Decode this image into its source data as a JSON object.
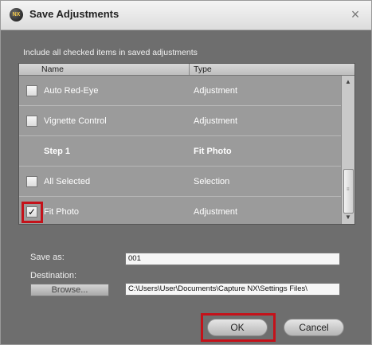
{
  "window": {
    "title": "Save Adjustments",
    "logo_text": "NX",
    "close_glyph": "×"
  },
  "instruction": "Include all checked items in saved adjustments",
  "list": {
    "columns": [
      "Name",
      "Type"
    ],
    "rows": [
      {
        "name": "Auto Red-Eye",
        "type": "Adjustment",
        "checked": false,
        "has_checkbox": true,
        "bold": false
      },
      {
        "name": "Vignette Control",
        "type": "Adjustment",
        "checked": false,
        "has_checkbox": true,
        "bold": false
      },
      {
        "name": "Step 1",
        "type": "Fit Photo",
        "checked": false,
        "has_checkbox": false,
        "bold": true
      },
      {
        "name": "All Selected",
        "type": "Selection",
        "checked": false,
        "has_checkbox": true,
        "bold": false
      },
      {
        "name": "Fit Photo",
        "type": "Adjustment",
        "checked": true,
        "has_checkbox": true,
        "bold": false
      }
    ],
    "check_glyph": "✓",
    "scroll_up_icon": "▲",
    "scroll_down_icon": "▼"
  },
  "save_as": {
    "label": "Save as:",
    "value": "001"
  },
  "destination": {
    "label": "Destination:",
    "browse_label": "Browse...",
    "path": "C:\\Users\\User\\Documents\\Capture NX\\Settings Files\\"
  },
  "buttons": {
    "ok": "OK",
    "cancel": "Cancel"
  },
  "colors": {
    "highlight": "#c4121a",
    "dialog_bg": "#6e6e6e"
  }
}
